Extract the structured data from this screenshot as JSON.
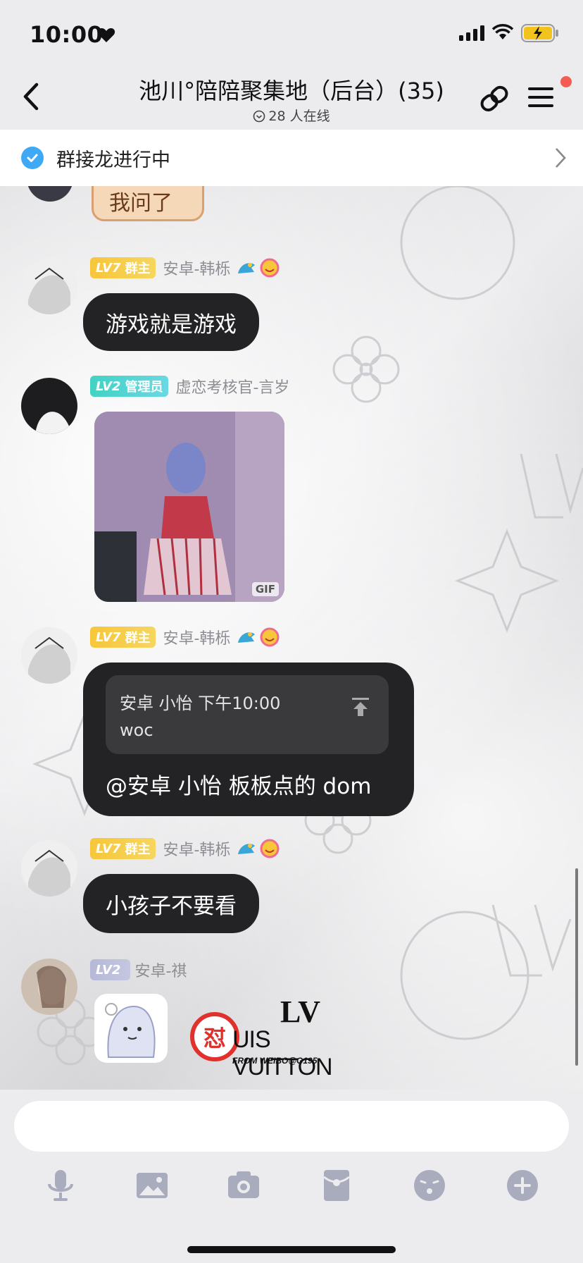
{
  "status_bar": {
    "time": "10:00"
  },
  "header": {
    "title": "池川°陪陪聚集地（后台）(35)",
    "online": "28 人在线"
  },
  "banner": {
    "text": "群接龙进行中"
  },
  "messages": [
    {
      "type": "sticker-partial",
      "sticker_text": "我问了"
    },
    {
      "level": "LV7",
      "role": "群主",
      "sender": "安卓-韩栎",
      "text": "游戏就是游戏"
    },
    {
      "level": "LV2",
      "role": "管理员",
      "sender": "虚恋考核官-言岁",
      "gif_badge": "GIF"
    },
    {
      "level": "LV7",
      "role": "群主",
      "sender": "安卓-韩栎",
      "quote_header": "安卓 小怡 下午10:00",
      "quote_body": "woc",
      "text": "@安卓 小怡 板板点的 dom"
    },
    {
      "level": "LV7",
      "role": "群主",
      "sender": "安卓-韩栎",
      "text": "小孩子不要看"
    },
    {
      "level": "LV2",
      "role": "",
      "sender": "安卓-祺",
      "sticker_brand": "UIS VUITTON",
      "sticker_credit": "FROM WEIBO@G195",
      "sticker_monogram": "LV",
      "sticker_seal": "怼"
    }
  ],
  "toolbar": {
    "icons": [
      "microphone-icon",
      "image-icon",
      "camera-icon",
      "red-packet-icon",
      "emoji-icon",
      "plus-icon"
    ]
  },
  "colors": {
    "bubble": "#232325",
    "accent_blue": "#3fa9f5",
    "badge_red": "#f45b52",
    "lv_gold": "#f7c63a",
    "lv_teal": "#43d2c3",
    "lv_grey": "#b6b9d6"
  }
}
